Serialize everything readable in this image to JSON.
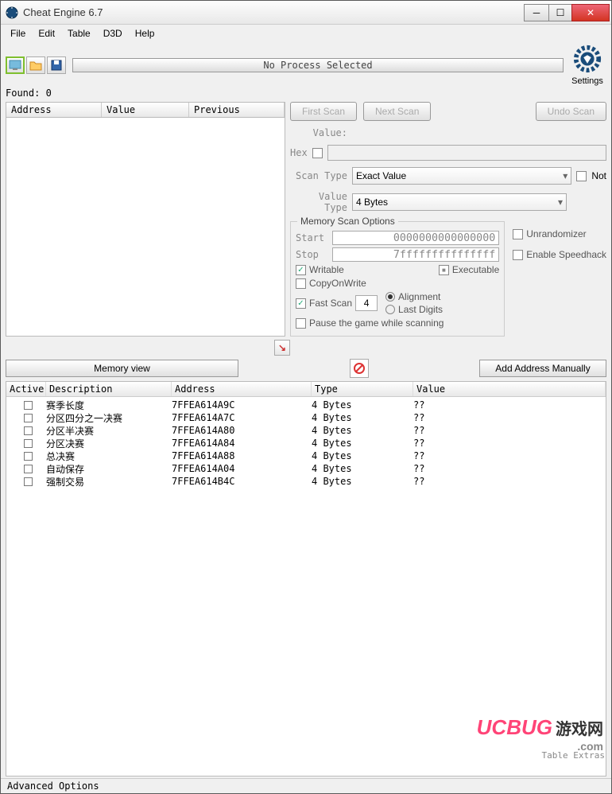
{
  "title": "Cheat Engine 6.7",
  "menu": {
    "file": "File",
    "edit": "Edit",
    "table": "Table",
    "d3d": "D3D",
    "help": "Help"
  },
  "progress_text": "No Process Selected",
  "found": "Found: 0",
  "result_headers": {
    "address": "Address",
    "value": "Value",
    "previous": "Previous"
  },
  "buttons": {
    "first_scan": "First Scan",
    "next_scan": "Next Scan",
    "undo_scan": "Undo Scan",
    "memory_view": "Memory view",
    "add_manual": "Add Address Manually"
  },
  "settings_label": "Settings",
  "labels": {
    "value": "Value:",
    "hex": "Hex",
    "scan_type": "Scan Type",
    "value_type": "Value Type",
    "not": "Not",
    "start": "Start",
    "stop": "Stop",
    "writable": "Writable",
    "executable": "Executable",
    "copyonwrite": "CopyOnWrite",
    "fast_scan": "Fast Scan",
    "alignment": "Alignment",
    "last_digits": "Last Digits",
    "pause": "Pause the game while scanning",
    "unrandomizer": "Unrandomizer",
    "speedhack": "Enable Speedhack"
  },
  "mem_group": "Memory Scan Options",
  "scan_type_value": "Exact Value",
  "value_type_value": "4 Bytes",
  "start_value": "0000000000000000",
  "stop_value": "7fffffffffffffff",
  "fast_scan_value": "4",
  "tbl_head": {
    "active": "Active",
    "desc": "Description",
    "addr": "Address",
    "type": "Type",
    "value": "Value"
  },
  "rows": [
    {
      "desc": "赛季长度",
      "addr": "7FFEA614A9C",
      "type": "4 Bytes",
      "value": "??"
    },
    {
      "desc": "分区四分之一决赛",
      "addr": "7FFEA614A7C",
      "type": "4 Bytes",
      "value": "??"
    },
    {
      "desc": "分区半决赛",
      "addr": "7FFEA614A80",
      "type": "4 Bytes",
      "value": "??"
    },
    {
      "desc": "分区决赛",
      "addr": "7FFEA614A84",
      "type": "4 Bytes",
      "value": "??"
    },
    {
      "desc": "总决赛",
      "addr": "7FFEA614A88",
      "type": "4 Bytes",
      "value": "??"
    },
    {
      "desc": "自动保存",
      "addr": "7FFEA614A04",
      "type": "4 Bytes",
      "value": "??"
    },
    {
      "desc": "强制交易",
      "addr": "7FFEA614B4C",
      "type": "4 Bytes",
      "value": "??"
    }
  ],
  "footer": "Advanced Options",
  "extras": "Table Extras",
  "watermark": "UCBUG",
  "watermark_cn": "游戏网",
  "watermark_sub": ".com"
}
